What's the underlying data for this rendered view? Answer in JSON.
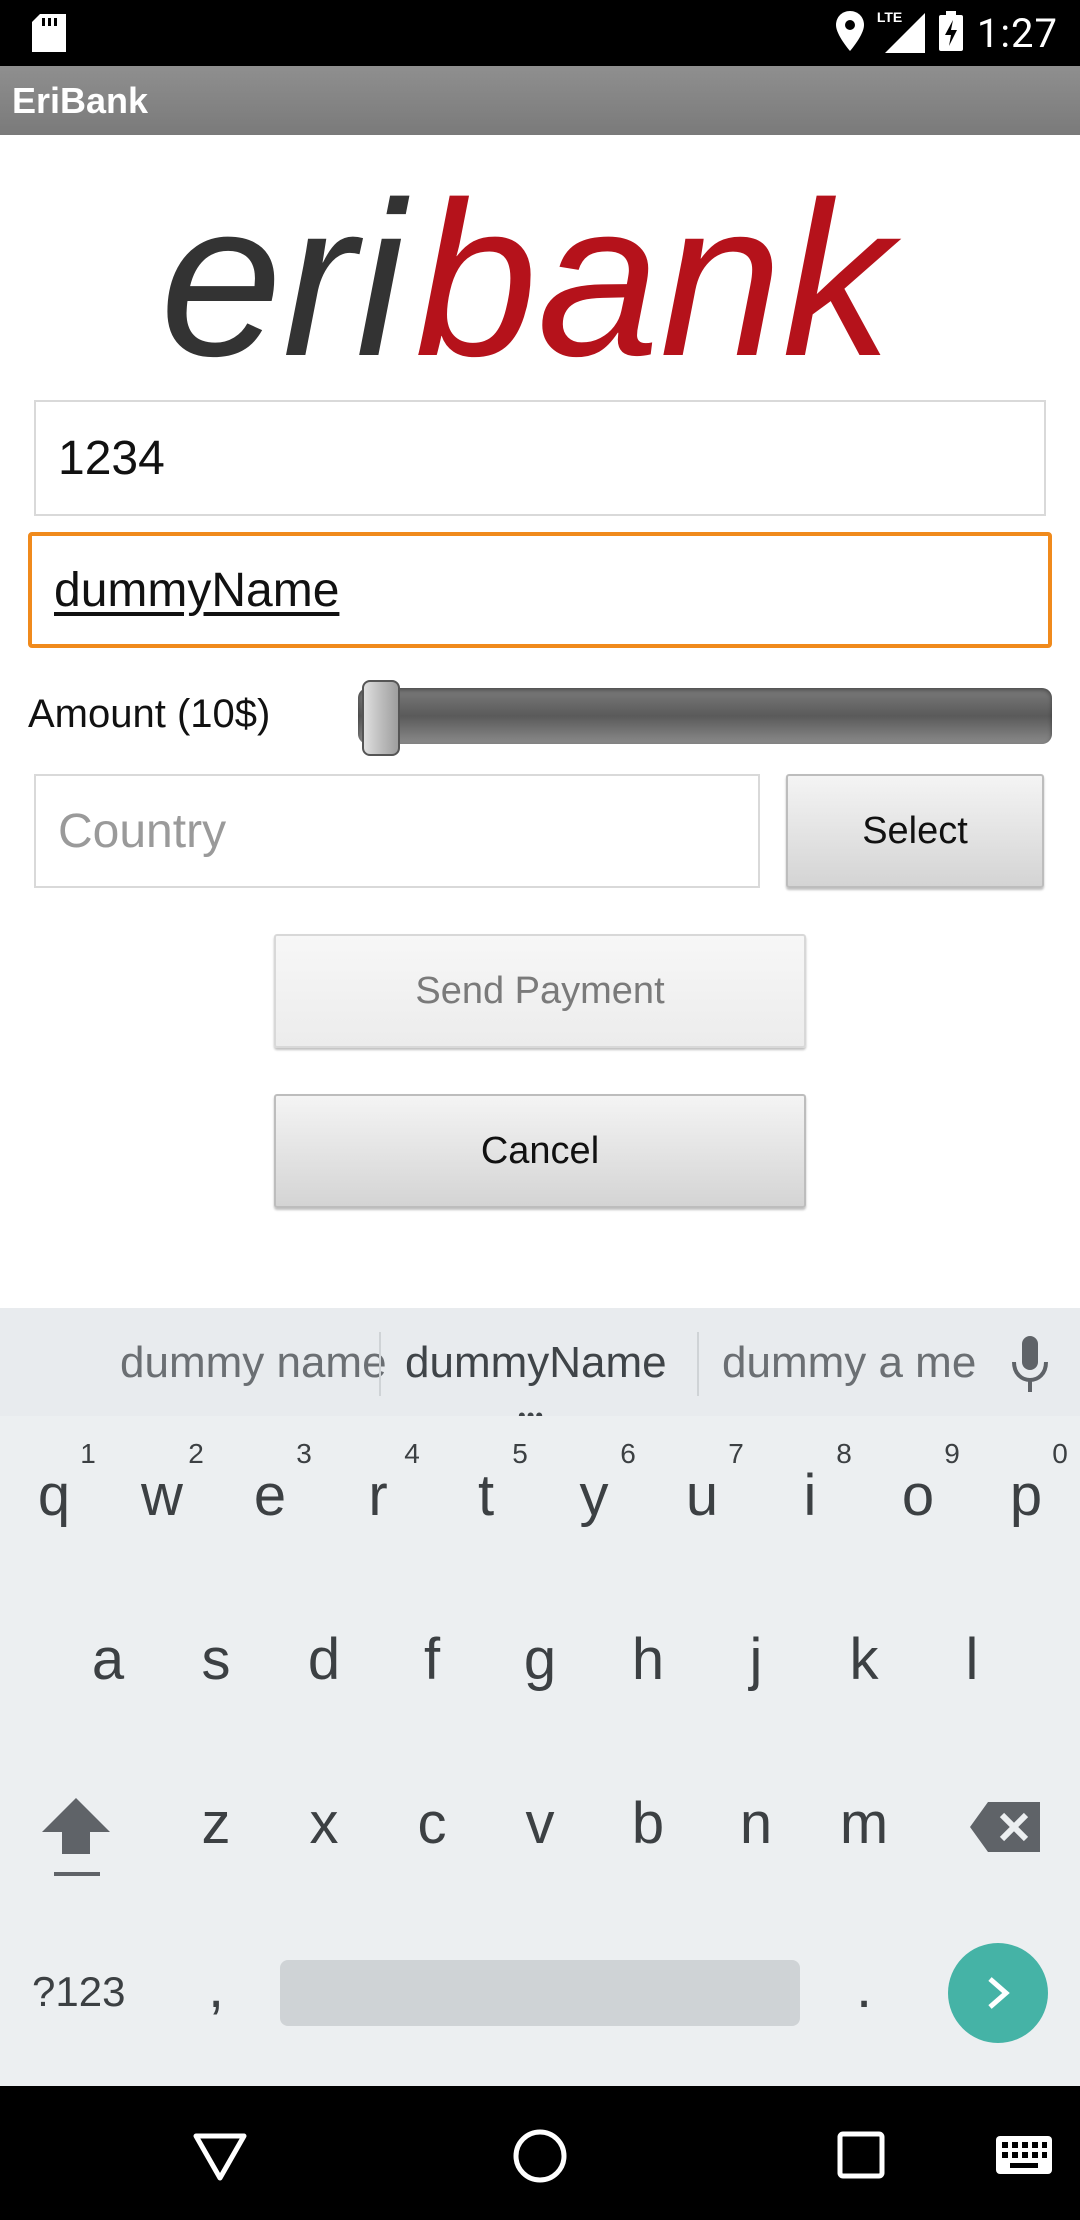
{
  "status_bar": {
    "time": "1:27",
    "network": "LTE"
  },
  "app": {
    "title": "EriBank"
  },
  "logo": {
    "text_dark": "eri",
    "text_red": "bank",
    "dark_color": "#333333",
    "red_color": "#b5121b"
  },
  "form": {
    "field1_value": "1234",
    "field2_value": "dummyName",
    "amount_label": "Amount (10$)",
    "amount_slider_value": 10,
    "country_placeholder": "Country",
    "select_label": "Select",
    "send_label": "Send Payment",
    "cancel_label": "Cancel"
  },
  "suggestions": [
    "dummy name",
    "dummyName",
    "dummy a me"
  ],
  "keyboard": {
    "row1": [
      "q",
      "w",
      "e",
      "r",
      "t",
      "y",
      "u",
      "i",
      "o",
      "p"
    ],
    "row1_nums": [
      "1",
      "2",
      "3",
      "4",
      "5",
      "6",
      "7",
      "8",
      "9",
      "0"
    ],
    "row2": [
      "a",
      "s",
      "d",
      "f",
      "g",
      "h",
      "j",
      "k",
      "l"
    ],
    "row3": [
      "z",
      "x",
      "c",
      "v",
      "b",
      "n",
      "m"
    ],
    "symbols_label": "?123",
    "comma": ",",
    "period": "."
  },
  "accent_color": "#f08a1c",
  "go_color": "#45b3a6"
}
